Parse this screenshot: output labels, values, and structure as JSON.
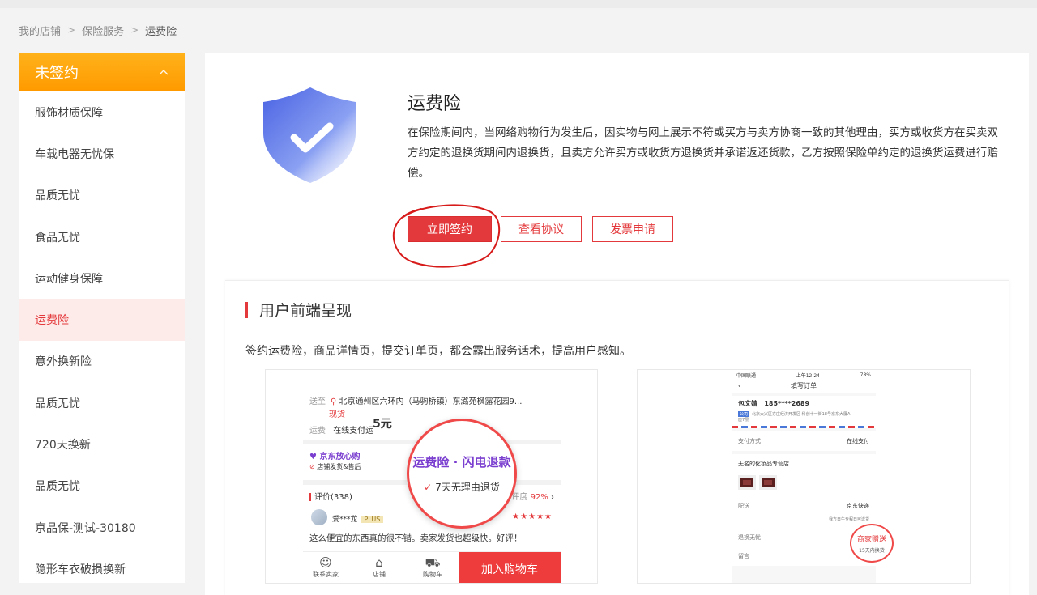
{
  "breadcrumb": {
    "items": [
      "我的店铺",
      "保险服务",
      "运费险"
    ],
    "separator": ">"
  },
  "sidebar": {
    "header": "未签约",
    "items": [
      {
        "label": "服饰材质保障"
      },
      {
        "label": "车载电器无忧保"
      },
      {
        "label": "品质无忧"
      },
      {
        "label": "食品无忧"
      },
      {
        "label": "运动健身保障"
      },
      {
        "label": "运费险",
        "active": true
      },
      {
        "label": "意外换新险"
      },
      {
        "label": "品质无忧"
      },
      {
        "label": "720天换新"
      },
      {
        "label": "品质无忧"
      },
      {
        "label": "京品保-测试-30180"
      },
      {
        "label": "隐形车衣破损换新"
      }
    ]
  },
  "product": {
    "title": "运费险",
    "description": "在保险期间内，当网络购物行为发生后，因实物与网上展示不符或买方与卖方协商一致的其他理由，买方或收货方在买卖双方约定的退换货期间内退换货，且卖方允许买方或收货方退换货并承诺返还货款，乙方按照保险单约定的退换货运费进行赔偿。",
    "buttons": {
      "sign": "立即签约",
      "agreement": "查看协议",
      "invoice": "发票申请"
    }
  },
  "frontend": {
    "title": "用户前端呈现",
    "description": "签约运费险，商品详情页，提交订单页，都会露出服务话术，提高用户感知。"
  },
  "preview1": {
    "ship_label": "送至",
    "address": "北京通州区六环内（马驹桥镇）东潞苑枫露花园9...",
    "stock": "现货",
    "price_fragment": "5元",
    "freight_label": "运费",
    "freight_value": "在线支付运",
    "service_brand": "京东放心购",
    "service_sub": "店铺发货&售后",
    "zoom_title": "运费险 · 闪电退款",
    "zoom_sub": "7天无理由退货",
    "reviews_label": "评价(338)",
    "rating_label": "好评度",
    "rating_value": "92%",
    "reviewer": "爱***龙",
    "plus": "PLUS",
    "stars": "★★★★★",
    "review_text": "这么便宜的东西真的很不错。卖家发货也超级快。好评！",
    "bottom": {
      "icon1": "联系卖家",
      "icon2": "店铺",
      "icon3": "购物车",
      "cart_button": "加入购物车"
    }
  },
  "preview2": {
    "status_left": "中国联通",
    "status_time": "上午12:24",
    "status_right": "78%",
    "header_title": "填写订单",
    "name": "包文婧",
    "phone": "185****2689",
    "address_tag": "公司",
    "address": "北京大兴区亦庄经济开发区 科创十一街18号京东大厦A座7层",
    "pay_label": "支付方式",
    "pay_value": "在线支付",
    "shop_name": "无名的化妆品专营店",
    "delivery_label": "配送",
    "delivery_value": "京东快递",
    "delivery_sub": "我方日午专程日可送货",
    "return_label": "退换无忧",
    "zoom_title": "商家赠送",
    "zoom_sub": "15天内换货",
    "note_label": "留言"
  },
  "colors": {
    "accent": "#e4393c",
    "sidebar_header": "#ffa50a",
    "shield": "#5b74e6"
  }
}
